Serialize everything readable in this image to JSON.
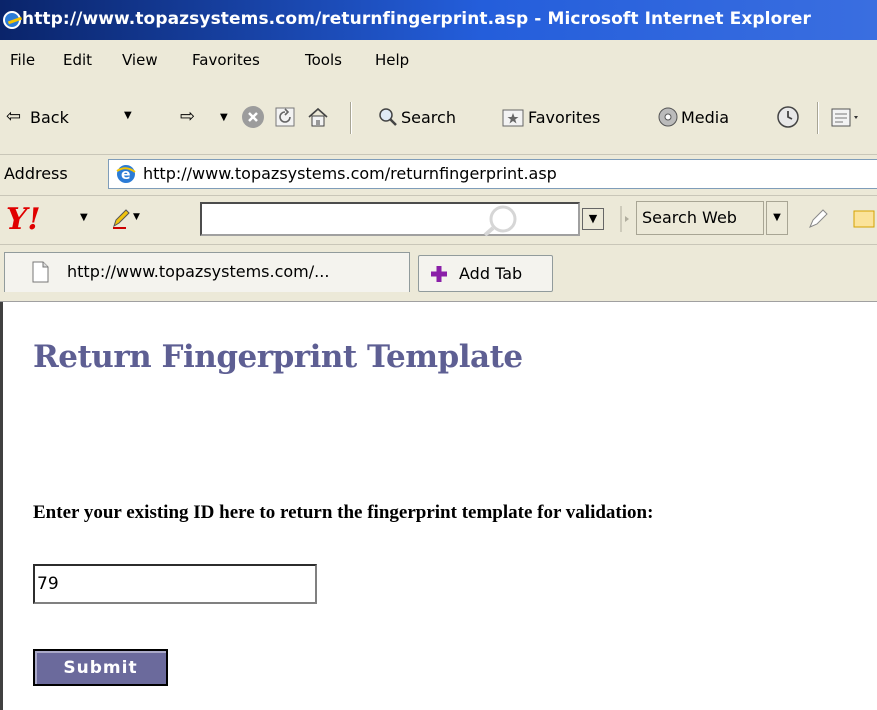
{
  "window": {
    "title": "http://www.topazsystems.com/returnfingerprint.asp - Microsoft Internet Explorer"
  },
  "menu": [
    "File",
    "Edit",
    "View",
    "Favorites",
    "Tools",
    "Help"
  ],
  "toolbar": {
    "back_label": "Back",
    "search_label": "Search",
    "favorites_label": "Favorites",
    "media_label": "Media"
  },
  "address": {
    "label": "Address",
    "url": "http://www.topazsystems.com/returnfingerprint.asp"
  },
  "yahoo": {
    "search_value": "",
    "search_web_label": "Search Web"
  },
  "tabs": {
    "active_label": "http://www.topazsystems.com/...",
    "add_tab_label": "Add Tab"
  },
  "page": {
    "heading": "Return Fingerprint Template",
    "prompt": "Enter your existing ID here to return the fingerprint template for validation:",
    "id_value": "79",
    "submit_label": "Submit"
  }
}
